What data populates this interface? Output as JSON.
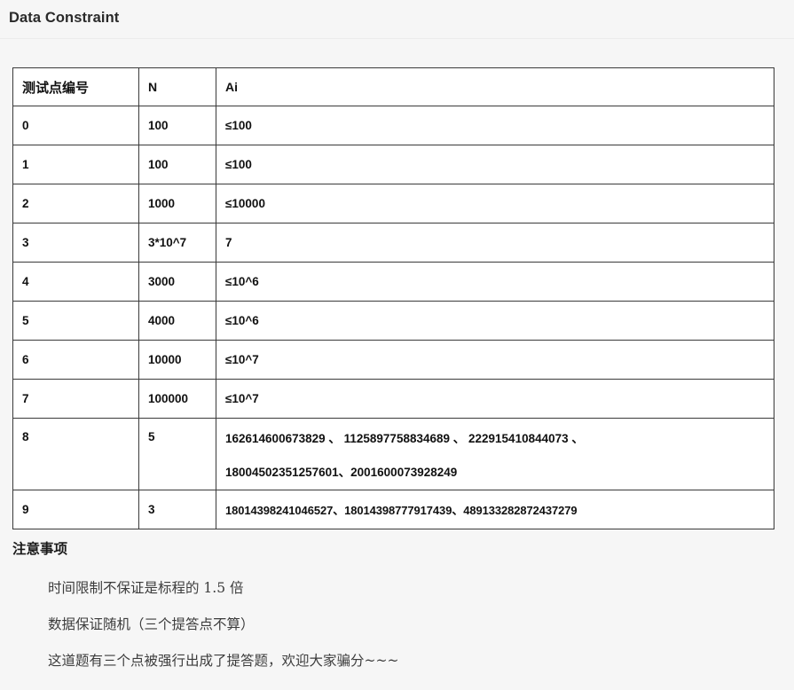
{
  "header": {
    "title": "Data Constraint"
  },
  "table": {
    "columns": [
      "测试点编号",
      "N",
      "Ai"
    ],
    "rows": [
      {
        "idx": "0",
        "n": "100",
        "ai": [
          "≤100"
        ]
      },
      {
        "idx": "1",
        "n": "100",
        "ai": [
          "≤100"
        ]
      },
      {
        "idx": "2",
        "n": "1000",
        "ai": [
          "≤10000"
        ]
      },
      {
        "idx": "3",
        "n": "3*10^7",
        "ai": [
          "7"
        ]
      },
      {
        "idx": "4",
        "n": "3000",
        "ai": [
          "≤10^6"
        ]
      },
      {
        "idx": "5",
        "n": "4000",
        "ai": [
          "≤10^6"
        ]
      },
      {
        "idx": "6",
        "n": "10000",
        "ai": [
          "≤10^7"
        ]
      },
      {
        "idx": "7",
        "n": "100000",
        "ai": [
          "≤10^7"
        ]
      },
      {
        "idx": "8",
        "n": "5",
        "ai": [
          "162614600673829 、 1125897758834689 、 222915410844073 、",
          "18004502351257601、2001600073928249"
        ],
        "tall": true
      },
      {
        "idx": "9",
        "n": "3",
        "ai": [
          "18014398241046527、18014398777917439、489133282872437279"
        ],
        "compact": true
      }
    ]
  },
  "notes": {
    "title": "注意事项",
    "items": [
      "时间限制不保证是标程的 1.5 倍",
      "数据保证随机（三个提答点不算）",
      "这道题有三个点被强行出成了提答题，欢迎大家骗分~~~"
    ]
  }
}
